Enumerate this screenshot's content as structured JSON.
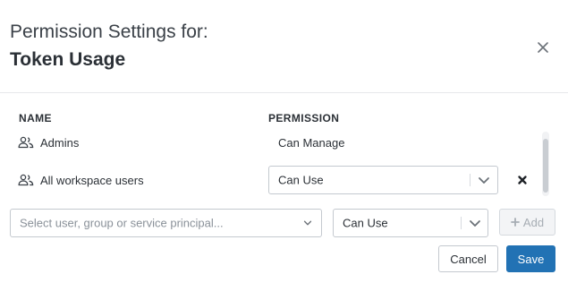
{
  "dialog": {
    "title_prefix": "Permission Settings for:",
    "title_object": "Token Usage"
  },
  "table": {
    "headers": {
      "name": "NAME",
      "permission": "PERMISSION"
    },
    "rows": [
      {
        "name": "Admins",
        "icon": "users-icon",
        "permission": "Can Manage",
        "editable": false
      },
      {
        "name": "All workspace users",
        "icon": "users-icon",
        "permission": "Can Use",
        "editable": true
      }
    ]
  },
  "add_row": {
    "principal_placeholder": "Select user, group or service principal...",
    "permission_value": "Can Use",
    "add_label": "Add"
  },
  "footer": {
    "cancel_label": "Cancel",
    "save_label": "Save"
  },
  "colors": {
    "primary": "#2272b4",
    "border": "#c4c9cf",
    "muted_text": "#8a9199"
  }
}
